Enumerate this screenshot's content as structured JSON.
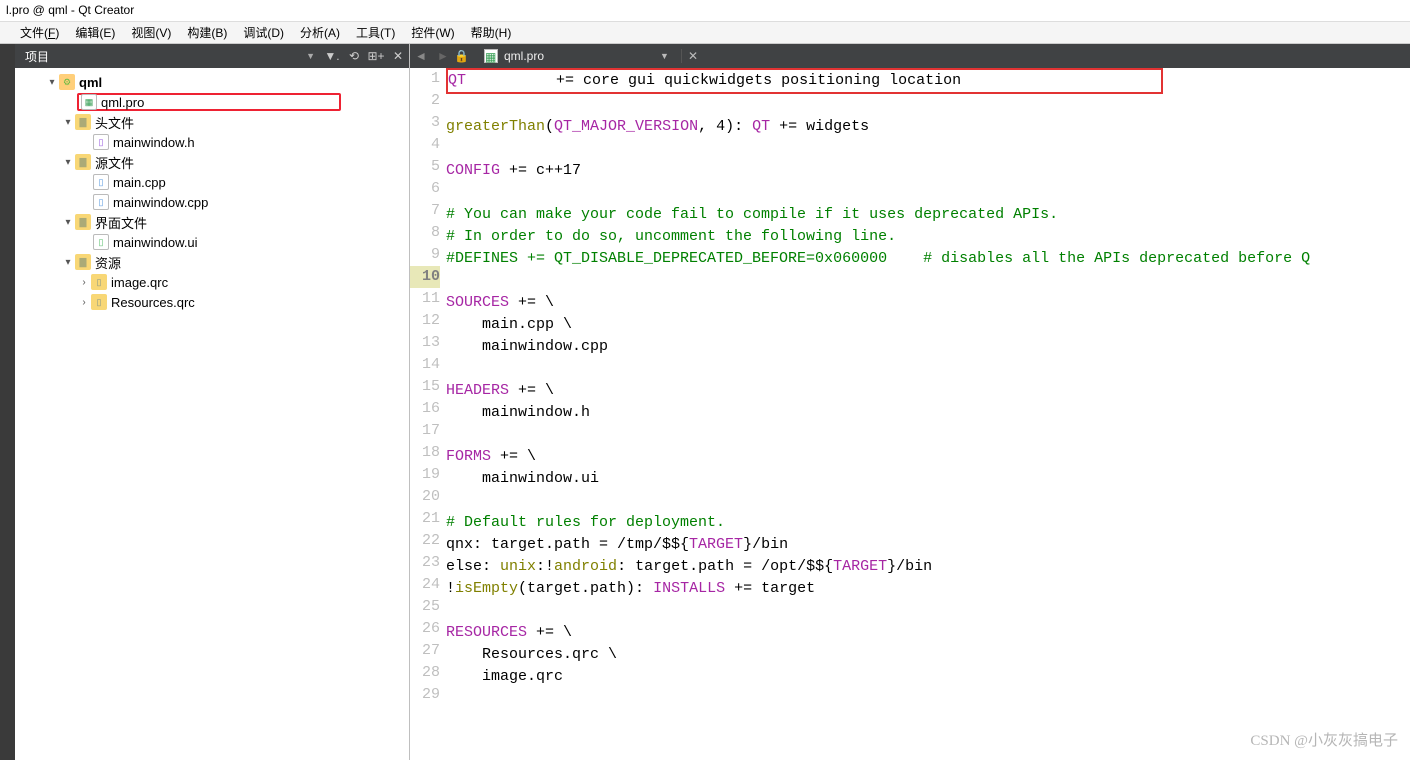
{
  "window_title": "l.pro @ qml - Qt Creator",
  "menu": {
    "file": "文件(F)",
    "edit": "编辑(E)",
    "view": "视图(V)",
    "build": "构建(B)",
    "debug": "调试(D)",
    "analyze": "分析(A)",
    "tools": "工具(T)",
    "widgets": "控件(W)",
    "help": "帮助(H)"
  },
  "sidebar": {
    "title": "项目",
    "tree": {
      "root": "qml",
      "selected_file": "qml.pro",
      "groups": [
        {
          "label": "头文件",
          "items": [
            "mainwindow.h"
          ]
        },
        {
          "label": "源文件",
          "items": [
            "main.cpp",
            "mainwindow.cpp"
          ]
        },
        {
          "label": "界面文件",
          "items": [
            "mainwindow.ui"
          ]
        },
        {
          "label": "资源",
          "items": [
            "image.qrc",
            "Resources.qrc"
          ]
        }
      ]
    }
  },
  "tab": {
    "filename": "qml.pro"
  },
  "editor": {
    "current_line": 10,
    "lines": [
      {
        "n": 1,
        "hlbox": true,
        "segs": [
          {
            "t": "QT          ",
            "c": "kw-purple"
          },
          {
            "t": "+= core gui quickwidgets positioning location"
          }
        ]
      },
      {
        "n": 2,
        "segs": []
      },
      {
        "n": 3,
        "segs": [
          {
            "t": "greaterThan",
            "c": "kw-olive"
          },
          {
            "t": "("
          },
          {
            "t": "QT_MAJOR_VERSION",
            "c": "kw-purple"
          },
          {
            "t": ", 4): "
          },
          {
            "t": "QT",
            "c": "kw-purple"
          },
          {
            "t": " += widgets"
          }
        ]
      },
      {
        "n": 4,
        "segs": []
      },
      {
        "n": 5,
        "segs": [
          {
            "t": "CONFIG",
            "c": "kw-purple"
          },
          {
            "t": " += c++17"
          }
        ]
      },
      {
        "n": 6,
        "segs": []
      },
      {
        "n": 7,
        "segs": [
          {
            "t": "# You can make your code fail to compile if it uses deprecated APIs.",
            "c": "kw-green"
          }
        ]
      },
      {
        "n": 8,
        "segs": [
          {
            "t": "# In order to do so, uncomment the following line.",
            "c": "kw-green"
          }
        ]
      },
      {
        "n": 9,
        "segs": [
          {
            "t": "#DEFINES += QT_DISABLE_DEPRECATED_BEFORE=0x060000    # disables all the APIs deprecated before Q",
            "c": "kw-green"
          }
        ]
      },
      {
        "n": 10,
        "segs": []
      },
      {
        "n": 11,
        "segs": [
          {
            "t": "SOURCES",
            "c": "kw-purple"
          },
          {
            "t": " += \\"
          }
        ]
      },
      {
        "n": 12,
        "segs": [
          {
            "t": "    main.cpp \\"
          }
        ]
      },
      {
        "n": 13,
        "segs": [
          {
            "t": "    mainwindow.cpp"
          }
        ]
      },
      {
        "n": 14,
        "segs": []
      },
      {
        "n": 15,
        "segs": [
          {
            "t": "HEADERS",
            "c": "kw-purple"
          },
          {
            "t": " += \\"
          }
        ]
      },
      {
        "n": 16,
        "segs": [
          {
            "t": "    mainwindow.h"
          }
        ]
      },
      {
        "n": 17,
        "segs": []
      },
      {
        "n": 18,
        "segs": [
          {
            "t": "FORMS",
            "c": "kw-purple"
          },
          {
            "t": " += \\"
          }
        ]
      },
      {
        "n": 19,
        "segs": [
          {
            "t": "    mainwindow.ui"
          }
        ]
      },
      {
        "n": 20,
        "segs": []
      },
      {
        "n": 21,
        "segs": [
          {
            "t": "# Default rules for deployment.",
            "c": "kw-green"
          }
        ]
      },
      {
        "n": 22,
        "segs": [
          {
            "t": "qnx: target.path = /tmp/$${"
          },
          {
            "t": "TARGET",
            "c": "kw-purple"
          },
          {
            "t": "}/bin"
          }
        ]
      },
      {
        "n": 23,
        "segs": [
          {
            "t": "else: "
          },
          {
            "t": "unix",
            "c": "kw-olive"
          },
          {
            "t": ":!"
          },
          {
            "t": "android",
            "c": "kw-olive"
          },
          {
            "t": ": target.path = /opt/$${"
          },
          {
            "t": "TARGET",
            "c": "kw-purple"
          },
          {
            "t": "}/bin"
          }
        ]
      },
      {
        "n": 24,
        "segs": [
          {
            "t": "!"
          },
          {
            "t": "isEmpty",
            "c": "kw-olive"
          },
          {
            "t": "(target.path): "
          },
          {
            "t": "INSTALLS",
            "c": "kw-purple"
          },
          {
            "t": " += target"
          }
        ]
      },
      {
        "n": 25,
        "segs": []
      },
      {
        "n": 26,
        "segs": [
          {
            "t": "RESOURCES",
            "c": "kw-purple"
          },
          {
            "t": " += \\"
          }
        ]
      },
      {
        "n": 27,
        "segs": [
          {
            "t": "    Resources.qrc \\"
          }
        ]
      },
      {
        "n": 28,
        "segs": [
          {
            "t": "    image.qrc"
          }
        ]
      },
      {
        "n": 29,
        "segs": []
      }
    ]
  },
  "watermark": "CSDN @小灰灰搞电子"
}
